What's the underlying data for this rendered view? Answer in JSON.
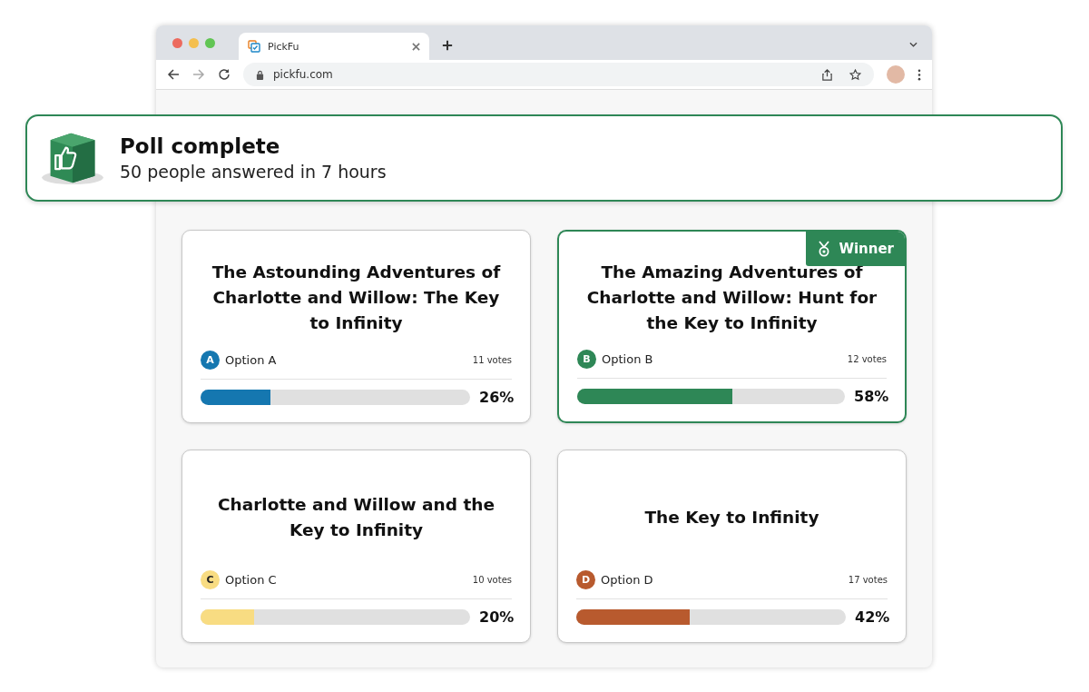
{
  "browser": {
    "tab_title": "PickFu",
    "url": "pickfu.com"
  },
  "banner": {
    "title": "Poll complete",
    "subtitle": "50 people answered in 7 hours"
  },
  "winner_badge": "Winner",
  "options": [
    {
      "letter": "A",
      "label": "Option A",
      "title": "The Astounding Adventures of Charlotte and Willow: The Key to Infinity",
      "votes": "11 votes",
      "percent": "26%",
      "level": 0.26,
      "color": "#1577b0",
      "winner": false
    },
    {
      "letter": "B",
      "label": "Option B",
      "title": "The Amazing Adventures of Charlotte and Willow: Hunt for the Key to Infinity",
      "votes": "12 votes",
      "percent": "58%",
      "level": 0.58,
      "color": "#2e8756",
      "winner": true
    },
    {
      "letter": "C",
      "label": "Option C",
      "title": "Charlotte and Willow and the Key to Infinity",
      "votes": "10 votes",
      "percent": "20%",
      "level": 0.2,
      "color": "#f8dc82",
      "winner": false
    },
    {
      "letter": "D",
      "label": "Option D",
      "title": "The Key to Infinity",
      "votes": "17 votes",
      "percent": "42%",
      "level": 0.42,
      "color": "#b85a2e",
      "winner": false
    }
  ]
}
